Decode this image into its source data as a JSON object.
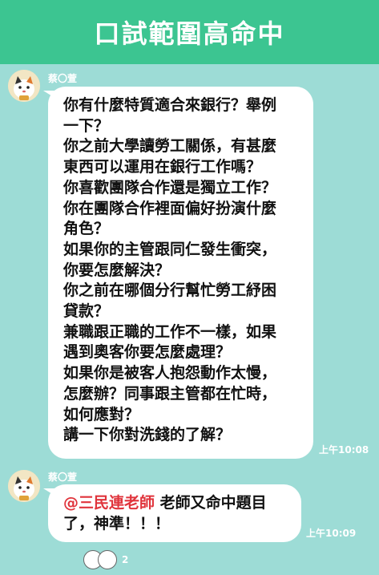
{
  "header": {
    "title": "口試範圍高命中"
  },
  "messages": [
    {
      "sender": "蔡〇萱",
      "lines": [
        "你有什麼特質適合來銀行？舉例",
        "一下？",
        "你之前大學讀勞工關係，有甚麼",
        "東西可以運用在銀行工作嗎？",
        "你喜歡團隊合作還是獨立工作？",
        "你在團隊合作裡面偏好扮演什麼",
        "角色？",
        "如果你的主管跟同仁發生衝突，",
        "你要怎麼解決？",
        "你之前在哪個分行幫忙勞工紓困",
        "貸款？",
        "兼職跟正職的工作不一樣，如果",
        "遇到奧客你要怎麼處理？",
        "如果你是被客人抱怨動作太慢，",
        "怎麼辦？同事跟主管都在忙時，",
        "如何應對？",
        "講一下你對洗錢的了解？"
      ],
      "time": "上午10:08"
    },
    {
      "sender": "蔡〇萱",
      "mention": "@三民連老師",
      "text_after_mention": " 老師又命中題目",
      "line2": "了，神準！！！",
      "time": "上午10:09"
    }
  ],
  "read_receipt": {
    "count": "2"
  },
  "colors": {
    "header": "#3cc591",
    "background": "#9ddcd6",
    "mention": "#e0343c"
  }
}
